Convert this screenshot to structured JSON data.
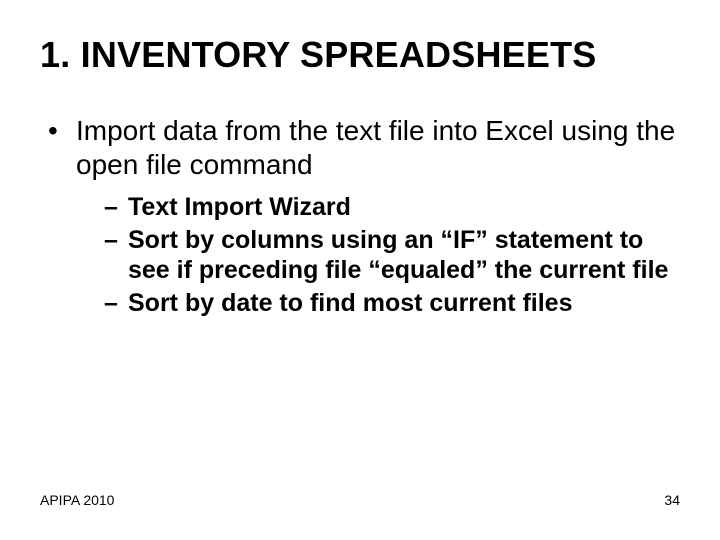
{
  "title": "1. INVENTORY SPREADSHEETS",
  "bullets": [
    {
      "text": "Import data from the text file into Excel using the open file command",
      "sub": [
        "Text Import Wizard",
        "Sort by columns using an “IF” statement to see if preceding file “equaled” the current file",
        "Sort by date to find most current files"
      ]
    }
  ],
  "footer": {
    "left": "APIPA 2010",
    "right": "34"
  }
}
